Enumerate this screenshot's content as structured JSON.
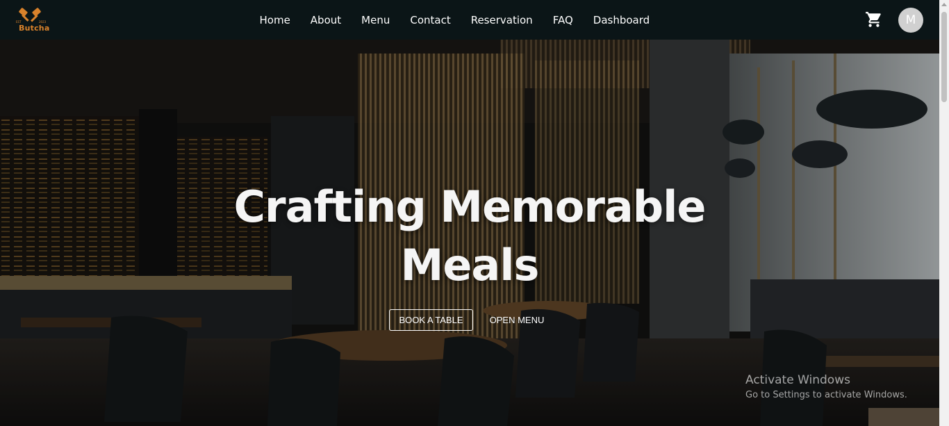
{
  "brand": {
    "name": "Butcha",
    "year_left": "EST",
    "year_right": "2023",
    "accent_color": "#d9822b"
  },
  "nav": {
    "items": [
      "Home",
      "About",
      "Menu",
      "Contact",
      "Reservation",
      "FAQ",
      "Dashboard"
    ],
    "cart_icon": "shopping-cart-icon",
    "avatar_initial": "M"
  },
  "hero": {
    "headline_line1": "Crafting Memorable",
    "headline_line2": "Meals",
    "book_button": "BOOK A TABLE",
    "menu_button": "OPEN MENU"
  },
  "watermark": {
    "title": "Activate Windows",
    "subtitle": "Go to Settings to activate Windows."
  }
}
